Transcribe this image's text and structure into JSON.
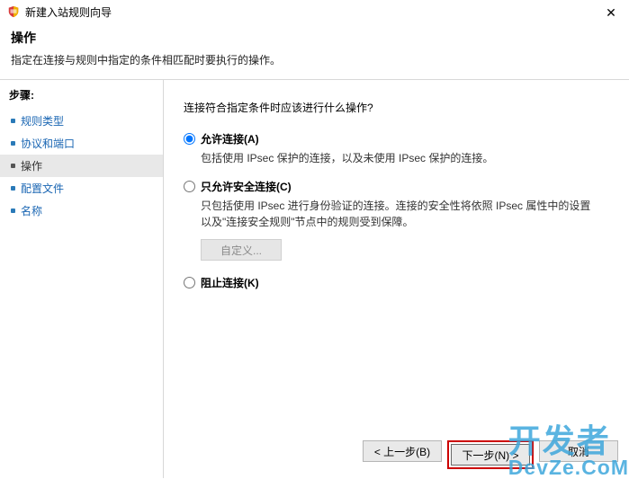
{
  "window": {
    "title": "新建入站规则向导",
    "close_glyph": "✕"
  },
  "header": {
    "title": "操作",
    "subtitle": "指定在连接与规则中指定的条件相匹配时要执行的操作。"
  },
  "sidebar": {
    "heading": "步骤:",
    "items": [
      {
        "label": "规则类型"
      },
      {
        "label": "协议和端口"
      },
      {
        "label": "操作"
      },
      {
        "label": "配置文件"
      },
      {
        "label": "名称"
      }
    ],
    "active_index": 2
  },
  "content": {
    "question": "连接符合指定条件时应该进行什么操作?",
    "options": {
      "allow": {
        "label": "允许连接(A)",
        "desc": "包括使用 IPsec 保护的连接，以及未使用 IPsec 保护的连接。"
      },
      "allow_secure": {
        "label": "只允许安全连接(C)",
        "desc": "只包括使用 IPsec 进行身份验证的连接。连接的安全性将依照 IPsec 属性中的设置以及\"连接安全规则\"节点中的规则受到保障。",
        "custom_button": "自定义..."
      },
      "block": {
        "label": "阻止连接(K)"
      }
    },
    "selected": "allow"
  },
  "footer": {
    "back": "< 上一步(B)",
    "next": "下一步(N) >",
    "cancel": "取消"
  },
  "watermark": {
    "line1": "开发者",
    "line2": "DevZe.CoM"
  }
}
